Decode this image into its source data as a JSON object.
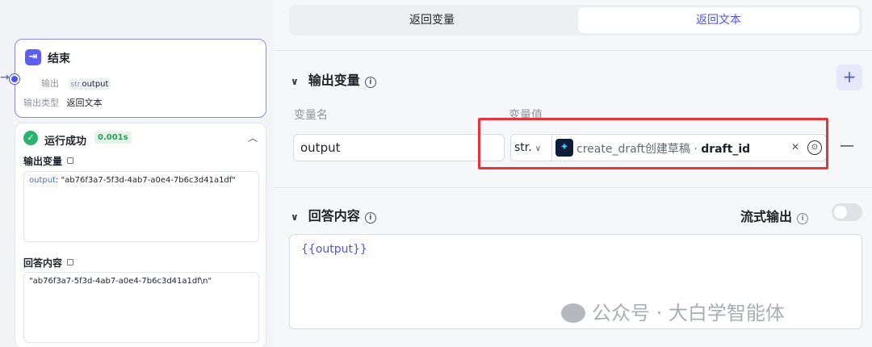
{
  "end_node": {
    "icon": "exit-icon",
    "title": "结束",
    "output_label": "输出",
    "output_type_prefix": "str.",
    "output_value": "output",
    "output_type_label": "输出类型",
    "output_type_value": "返回文本"
  },
  "result": {
    "status": "运行成功",
    "time": "0.001s",
    "output_var_label": "输出变量",
    "output_key": "output",
    "output_val": ": \"ab76f3a7-5f3d-4ab7-a0e4-7b6c3d41a1df\"",
    "answer_label": "回答内容",
    "answer_val": "\"ab76f3a7-5f3d-4ab7-a0e4-7b6c3d41a1df\\n\""
  },
  "tabs": [
    {
      "label": "返回变量",
      "active": false
    },
    {
      "label": "返回文本",
      "active": true
    }
  ],
  "output_section": {
    "title": "输出变量",
    "add_label": "+",
    "col_name": "变量名",
    "col_value": "变量值",
    "row": {
      "name": "output",
      "type": "str.",
      "ref_prefix": "create_draft创建草稿 · ",
      "ref_field": "draft_id",
      "remove_label": "—"
    }
  },
  "answer_section": {
    "title": "回答内容",
    "stream_label": "流式输出",
    "stream_enabled": false,
    "content": "{{output}}"
  },
  "watermark": "公众号 · 大白学智能体",
  "colors": {
    "accent": "#4d53e8",
    "success": "#2bb36f",
    "highlight": "#e8333b"
  }
}
